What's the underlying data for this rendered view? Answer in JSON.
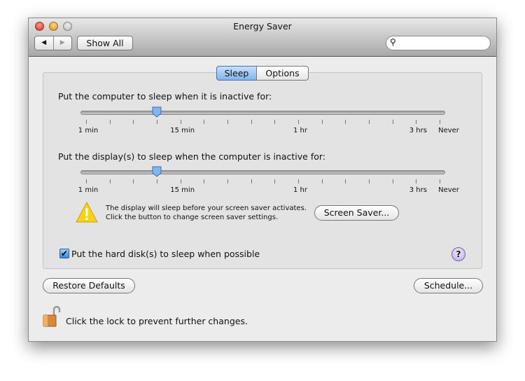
{
  "window": {
    "title": "Energy Saver"
  },
  "toolbar": {
    "back_icon": "triangle-left",
    "forward_icon": "triangle-right",
    "show_all": "Show All",
    "search": {
      "value": "",
      "placeholder": "",
      "icon": "magnifier-icon"
    }
  },
  "tabs": [
    {
      "label": "Sleep",
      "selected": true
    },
    {
      "label": "Options",
      "selected": false
    }
  ],
  "computer_sleep": {
    "label": "Put the computer to sleep when it is inactive for:",
    "tick_labels": [
      "1 min",
      "15 min",
      "1 hr",
      "3 hrs",
      "Never"
    ],
    "value_tick_index": 3,
    "tick_count": 16
  },
  "display_sleep": {
    "label": "Put the display(s) to sleep when the computer is inactive for:",
    "tick_labels": [
      "1 min",
      "15 min",
      "1 hr",
      "3 hrs",
      "Never"
    ],
    "value_tick_index": 3,
    "tick_count": 16
  },
  "warning": {
    "line1": "The display will sleep before your screen saver activates.",
    "line2": "Click the button to change screen saver settings.",
    "button": "Screen Saver..."
  },
  "hard_disk": {
    "label": "Put the hard disk(s) to sleep when possible",
    "checked": true
  },
  "help": "?",
  "restore_defaults": "Restore Defaults",
  "schedule": "Schedule...",
  "lock": {
    "text": "Click the lock to prevent further changes.",
    "state": "unlocked"
  },
  "colors": {
    "close": "#e0443e",
    "minimize": "#e9a23b",
    "zoom_disabled": "#c8c8c8",
    "tab_selected": "#9cc7f5",
    "help": "#c9b8ef"
  }
}
